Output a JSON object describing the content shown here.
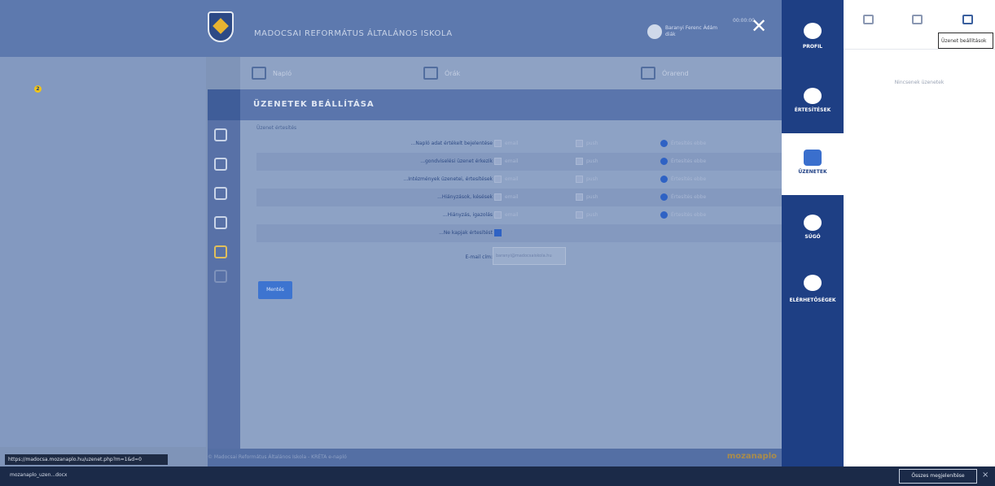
{
  "header": {
    "school_name": "MADOCSAI REFORMÁTUS ÁLTALÁNOS ISKOLA",
    "user_name": "Baranyi Ferenc Ádám",
    "user_role": "diák",
    "session": "00:00:00",
    "close_icon": "close-icon"
  },
  "toolbar": {
    "item1": "Napló",
    "item2": "Órák",
    "item3": "Órarend"
  },
  "section": {
    "title": "ÜZENETEK BEÁLLÍTÁSA",
    "group_title": "Üzenet értesítés"
  },
  "settings": {
    "rows": [
      {
        "label": "...Napló adat értékelt bejelentése"
      },
      {
        "label": "...gondviselési üzenet érkezik"
      },
      {
        "label": "...Intézmények üzenetei, értesítések"
      },
      {
        "label": "...Hiányzások, késések"
      },
      {
        "label": "...Hiányzás, igazolás"
      }
    ],
    "cb1_text": "email",
    "cb2_text": "push",
    "radio_text": "Értesítés ebbe",
    "notify_label": "...Ne kapjak értesítést",
    "email_label": "E-mail cím:",
    "email_value": "baranyi@madocsaiskola.hu",
    "save_label": "Mentés"
  },
  "footer": {
    "text": "© Madocsai Református Általános Iskola - KRÉTA e-napló",
    "brand": "mozanaplo",
    "status_url": "https://madocsa.mozanaplo.hu/uzenet.php?m=1&d=0"
  },
  "rnav": {
    "profile": "PROFIL",
    "notifications": "ÉRTESÍTÉSEK",
    "messages": "ÜZENETEK",
    "help": "SÚGÓ",
    "contacts": "ELÉRHETŐSÉGEK",
    "badge": "2"
  },
  "drawer": {
    "tooltip": "Üzenet beállítások",
    "no_messages": "Nincsenek üzenetek"
  },
  "taskbar": {
    "app": "mozanaplo_uzen...docx",
    "show_all": "Összes megjelenítése",
    "close": "×"
  },
  "colors": {
    "nav": "#1e3f84",
    "accent": "#2f62c4",
    "gold": "#e7b331"
  }
}
